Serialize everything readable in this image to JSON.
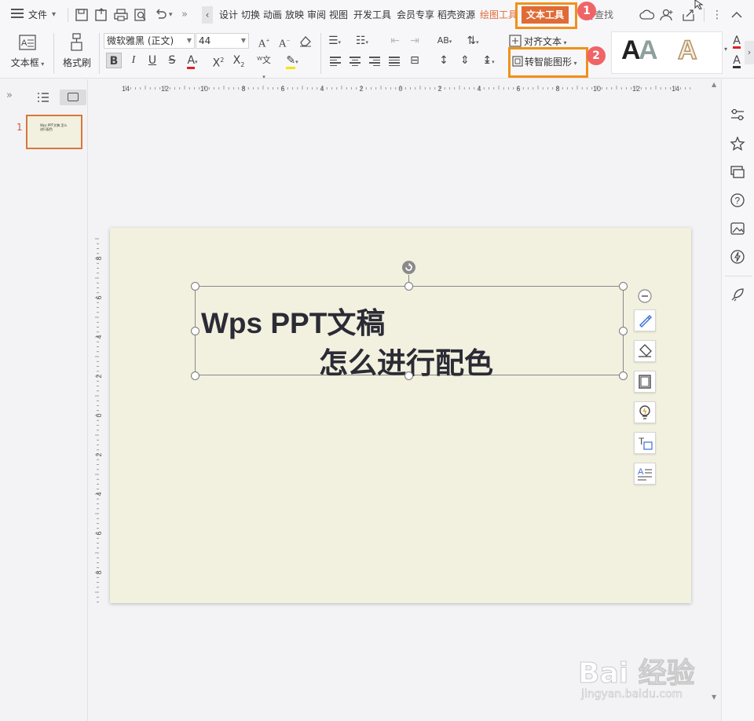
{
  "titlebar": {
    "file_label": "文件",
    "tabs": [
      "设计",
      "切换",
      "动画",
      "放映",
      "审阅",
      "视图",
      "开发工具",
      "会员专享",
      "稻壳资源",
      "绘图工具",
      "文本工具"
    ],
    "search_label": "查找"
  },
  "ribbon": {
    "textbox_label": "文本框",
    "format_brush_label": "格式刷",
    "font_name": "微软雅黑 (正文)",
    "font_size": "44",
    "align_text_label": "对齐文本",
    "smart_shape_label": "转智能图形",
    "wordart_letter": "A"
  },
  "slides_panel": {
    "slide_number": "1",
    "thumb_text": "Wps PPT文稿 怎么进行配色"
  },
  "slide": {
    "title_line1": "Wps PPT文稿",
    "title_line2": "怎么进行配色"
  },
  "annotations": {
    "badge1": "1",
    "badge2": "2"
  },
  "watermark": {
    "logo_text": "Bai 经验",
    "url": "jingyan.baidu.com"
  },
  "colors": {
    "accent": "#e06b36",
    "annotation": "#f0911c",
    "badge": "#f06466",
    "slide_bg": "#f2f0df"
  }
}
